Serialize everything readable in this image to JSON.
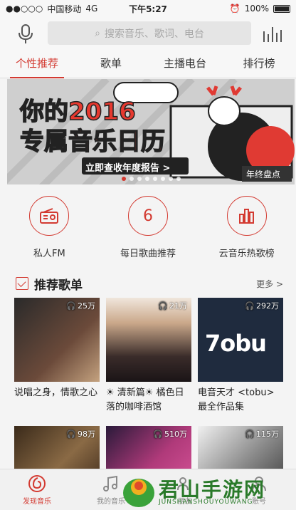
{
  "status": {
    "carrier": "中国移动",
    "network": "4G",
    "time": "下午5:27",
    "battery": "100%"
  },
  "search": {
    "placeholder": "搜索音乐、歌词、电台"
  },
  "tabs": [
    "个性推荐",
    "歌单",
    "主播电台",
    "排行榜"
  ],
  "banner": {
    "line1": "你的2016",
    "line2": "专属音乐日历",
    "cta": "立即查收年度报告 >",
    "badge": "年终盘点"
  },
  "quick": [
    {
      "label": "私人FM",
      "icon": "radio-icon"
    },
    {
      "label": "每日歌曲推荐",
      "glyph": "6",
      "icon": "calendar-icon"
    },
    {
      "label": "云音乐热歌榜",
      "icon": "chart-bars-icon"
    }
  ],
  "section": {
    "title": "推荐歌单",
    "more": "更多 >"
  },
  "playlists": [
    {
      "count": "25万",
      "title": "说唱之身，情歌之心",
      "color": "#4a3a33"
    },
    {
      "count": "21万",
      "title": "☀ 清新篇☀ 橘色日落的咖啡酒馆",
      "color": "#3b2f35"
    },
    {
      "count": "292万",
      "title": "电音天才 <tobu> 最全作品集",
      "color": "#1e2a3a"
    },
    {
      "count": "98万",
      "title": "",
      "color": "#5a3d2a"
    },
    {
      "count": "510万",
      "title": "",
      "color": "#6a2a55"
    },
    {
      "count": "115万",
      "title": "",
      "color": "#3d3d3d"
    }
  ],
  "bottom": [
    {
      "label": "发现音乐",
      "active": true
    },
    {
      "label": "我的音乐",
      "active": false
    },
    {
      "label": "朋友",
      "active": false
    },
    {
      "label": "账号",
      "active": false
    }
  ],
  "watermark": {
    "title": "君山手游网",
    "site": "JUNSHANSHOUYOUWANG"
  },
  "colors": {
    "accent": "#d33a31"
  }
}
